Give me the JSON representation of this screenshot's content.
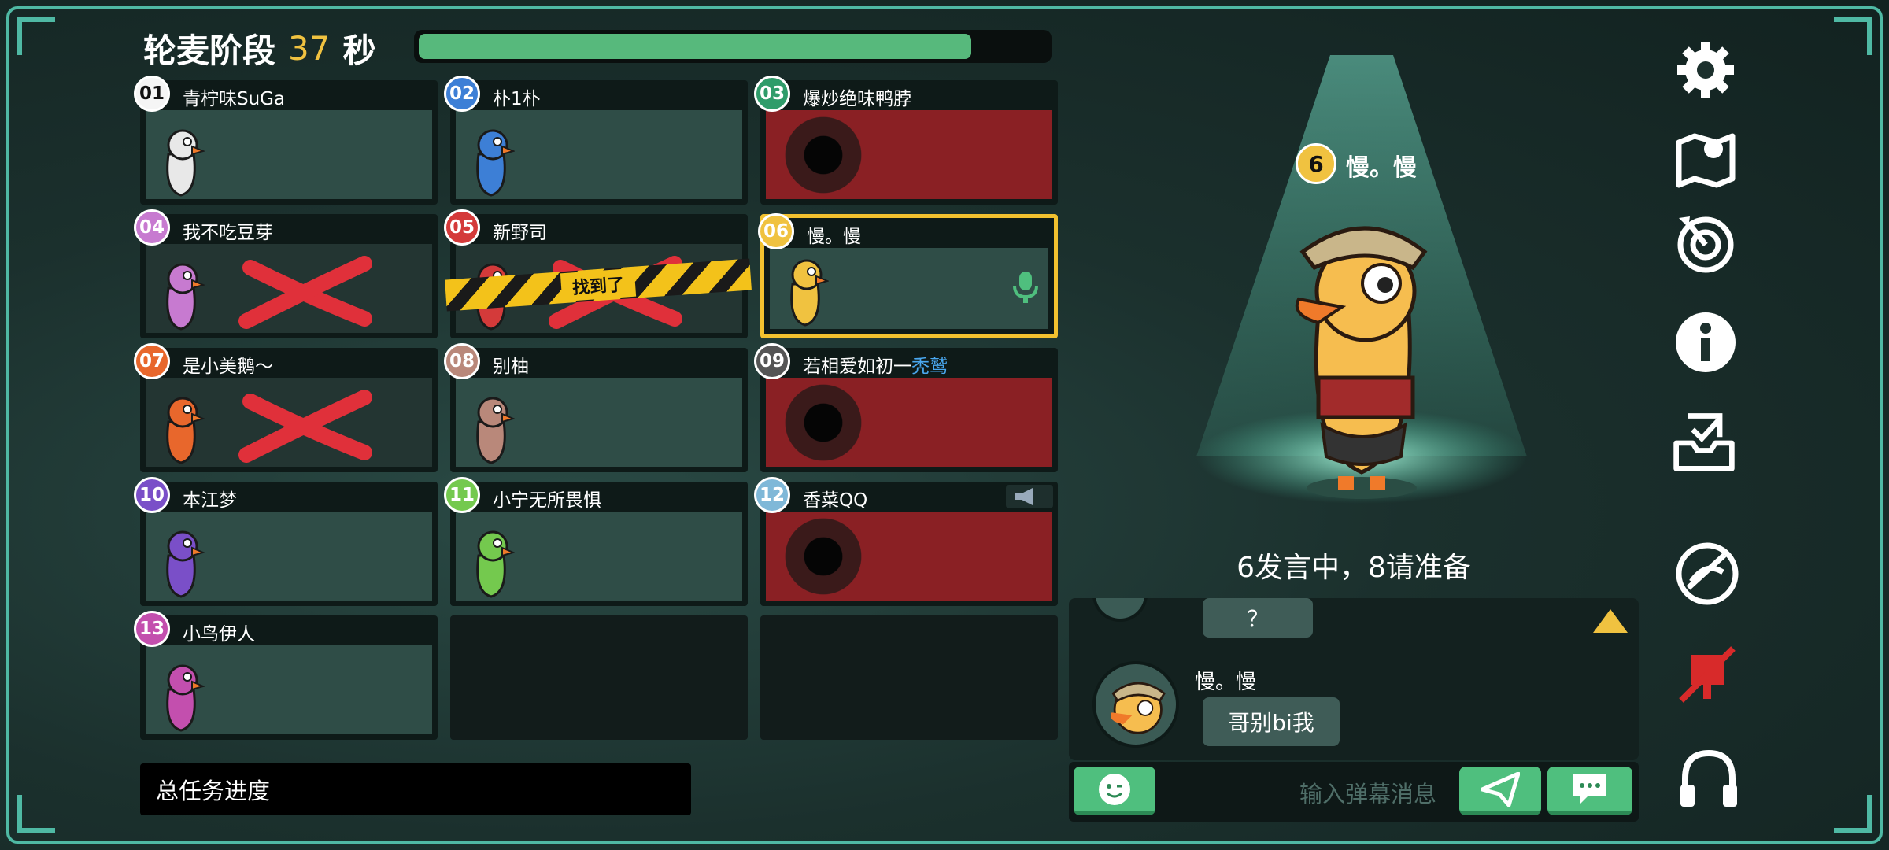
{
  "header": {
    "phase_label": "轮麦阶段",
    "seconds": "37",
    "seconds_unit": "秒",
    "time_remaining_fraction": 0.88
  },
  "players": [
    {
      "num": "01",
      "name": "青柠味SuGa",
      "badge_color": "#f5f5f5",
      "state": "alive"
    },
    {
      "num": "02",
      "name": "朴1朴",
      "badge_color": "#3d7fd6",
      "state": "alive"
    },
    {
      "num": "03",
      "name": "爆炒绝味鸭脖",
      "badge_color": "#2f9c6a",
      "state": "disconnected"
    },
    {
      "num": "04",
      "name": "我不吃豆芽",
      "badge_color": "#c77ad0",
      "state": "dead"
    },
    {
      "num": "05",
      "name": "新野司",
      "badge_color": "#d43a3a",
      "state": "found"
    },
    {
      "num": "06",
      "name": "慢。慢",
      "badge_color": "#f0c240",
      "state": "speaking"
    },
    {
      "num": "07",
      "name": "是小美鹅～",
      "badge_color": "#e8672c",
      "state": "dead"
    },
    {
      "num": "08",
      "name": "别柚",
      "badge_color": "#b9887a",
      "state": "alive"
    },
    {
      "num": "09",
      "name": "若相爱如初一",
      "name_suffix": "秃鹫",
      "badge_color": "#555555",
      "state": "disconnected"
    },
    {
      "num": "10",
      "name": "本江梦",
      "badge_color": "#7a4fc8",
      "state": "alive"
    },
    {
      "num": "11",
      "name": "小宁无所畏惧",
      "badge_color": "#74c94e",
      "state": "alive"
    },
    {
      "num": "12",
      "name": "香菜QQ",
      "badge_color": "#7fb8d8",
      "state": "disconnected"
    },
    {
      "num": "13",
      "name": "小鸟伊人",
      "badge_color": "#c34fae",
      "state": "alive"
    }
  ],
  "found_tape_text": "找到了",
  "task_progress_label": "总任务进度",
  "speaker": {
    "num": "6",
    "name": "慢。慢"
  },
  "turn_status": "6发言中，8请准备",
  "chat": {
    "messages": [
      {
        "author": "",
        "text": "？"
      },
      {
        "author": "慢。慢",
        "text": "哥别bi我"
      }
    ],
    "input_placeholder": "输入弹幕消息"
  },
  "rail_icons": [
    "gear-icon",
    "map-icon",
    "target-icon",
    "info-icon",
    "task-inbox-icon",
    "no-speed-icon",
    "mic-muted-icon",
    "headphones-icon"
  ],
  "colors": {
    "accent": "#4fb9a4",
    "time_bar": "#57b97c",
    "active_border": "#f2c12f",
    "button_green": "#4fbf7e",
    "mic_muted": "#d82a2a"
  }
}
